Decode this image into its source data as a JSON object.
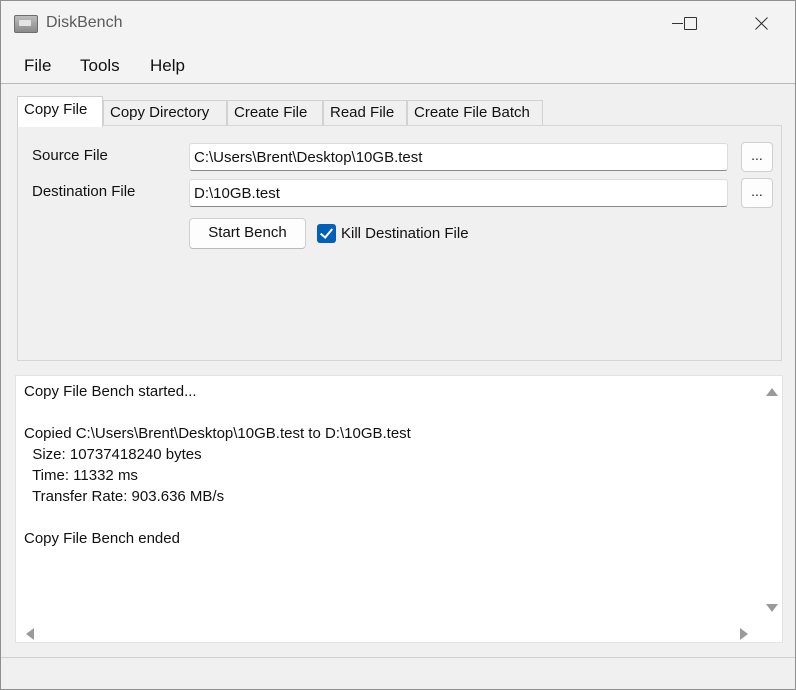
{
  "window": {
    "title": "DiskBench"
  },
  "menu": {
    "items": [
      "File",
      "Tools",
      "Help"
    ]
  },
  "tabs": [
    "Copy File",
    "Copy Directory",
    "Create File",
    "Read File",
    "Create File Batch"
  ],
  "form": {
    "source_label": "Source File",
    "source_value": "C:\\Users\\Brent\\Desktop\\10GB.test",
    "dest_label": "Destination File",
    "dest_value": "D:\\10GB.test",
    "browse_label": "...",
    "start_label": "Start Bench",
    "kill_label": "Kill Destination File"
  },
  "log": {
    "lines": [
      "Copy File Bench started...",
      "",
      "Copied C:\\Users\\Brent\\Desktop\\10GB.test to D:\\10GB.test",
      "  Size: 10737418240 bytes",
      "  Time: 11332 ms",
      "  Transfer Rate: 903.636 MB/s",
      "",
      "Copy File Bench ended"
    ]
  },
  "colors": {
    "accent": "#005fb8"
  }
}
